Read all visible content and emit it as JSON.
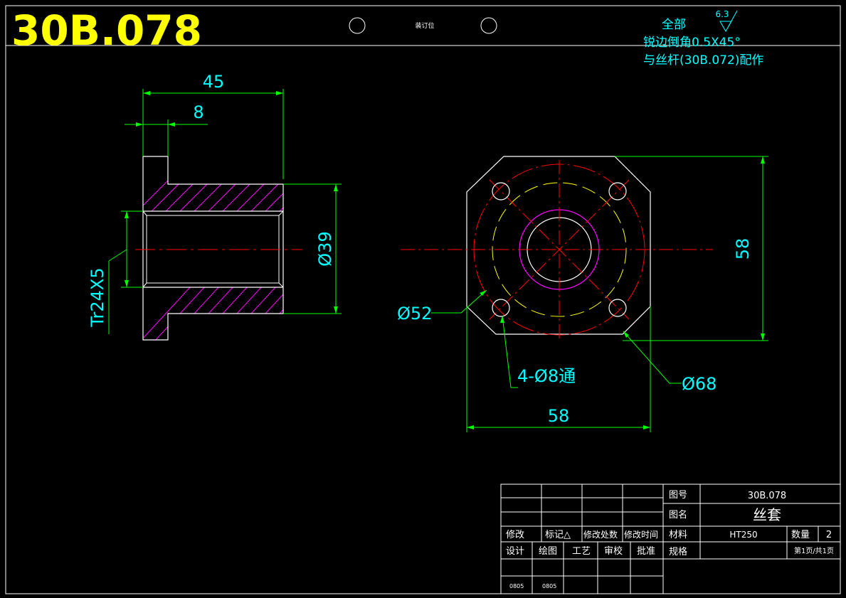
{
  "drawing_number_large": "30B.078",
  "binding_label": "装订位",
  "notes": {
    "scope": "全部",
    "roughness": "6.3",
    "chamfer": "锐边倒角0.5X45°",
    "pairing": "与丝杆(30B.072)配作"
  },
  "dimensions": {
    "length_total": "45",
    "flange_thickness": "8",
    "outer_diameter": "Ø39",
    "thread": "Tr24X5",
    "bolt_circle": "Ø52",
    "holes": "4-Ø8通",
    "flange_diameter": "Ø68",
    "width": "58",
    "height": "58"
  },
  "title_block": {
    "drawing_no_label": "图号",
    "drawing_no": "30B.078",
    "name_label": "图名",
    "name": "丝套",
    "material_label": "材料",
    "material": "HT250",
    "quantity_label": "数量",
    "quantity": "2",
    "spec_label": "规格",
    "sheet": "第1页/共1页",
    "rev_headers": [
      "修改",
      "标记△",
      "修改处数",
      "修改时间"
    ],
    "sign_headers": [
      "设计",
      "绘图",
      "工艺",
      "审校",
      "批准"
    ],
    "dates": [
      "0805",
      "0805"
    ]
  },
  "colors": {
    "outline": "#ffffff",
    "dimension": "#00ff00",
    "dim_text": "#00ffff",
    "hatch": "#ff00ff",
    "centerline": "#ff0000",
    "hidden": "#ffff00",
    "title": "#ffff00"
  }
}
